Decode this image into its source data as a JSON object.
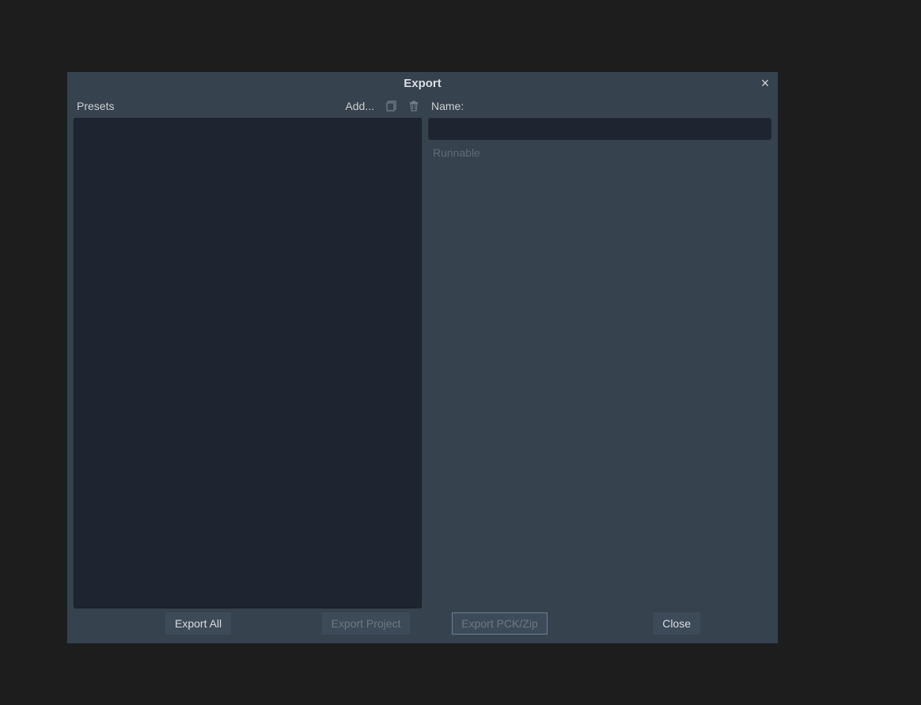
{
  "dialog": {
    "title": "Export",
    "close_glyph": "×"
  },
  "presets": {
    "label": "Presets",
    "add_label": "Add..."
  },
  "right": {
    "name_label": "Name:",
    "name_value": "",
    "runnable_label": "Runnable"
  },
  "footer": {
    "export_all": "Export All",
    "export_project": "Export Project",
    "export_pck": "Export PCK/Zip",
    "close": "Close"
  }
}
